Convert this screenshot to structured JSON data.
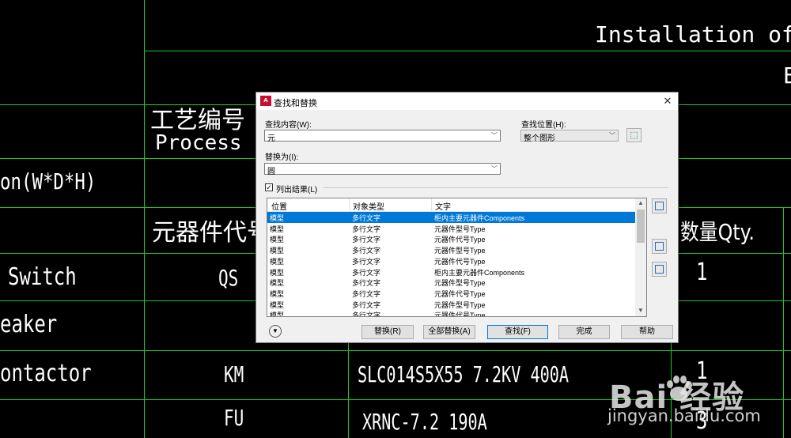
{
  "cad": {
    "install_title": "Installation of",
    "row2_partial": "E",
    "process_label_cn": "工艺编号",
    "process_label_en": "Process",
    "dim_label": "on(W*D*H)",
    "component_code_label": "元器件代号",
    "qty_label": "数量Qty.",
    "switch_label": "Switch",
    "qs": "QS",
    "qty1": "1",
    "breaker_label": "eaker",
    "contactor_label": "ontactor",
    "km": "KM",
    "km_spec": "SLC014S5X55 7.2KV  400A",
    "qty_km": "1",
    "fu": "FU",
    "fu_spec": "XRNC-7.2  190A",
    "qty_fu": "3"
  },
  "dialog": {
    "app_icon": "A",
    "title": "查找和替换",
    "close_glyph": "✕",
    "find_label": "查找内容(W):",
    "find_value": "元",
    "find_in_label": "查找位置(H):",
    "find_in_value": "整个图形",
    "replace_label": "替换为(I):",
    "replace_value": "圆",
    "list_results_label": "列出结果(L)",
    "list_results_checked": "✓",
    "columns": [
      "位置",
      "对象类型",
      "文字"
    ],
    "rows": [
      {
        "location": "模型",
        "type": "多行文字",
        "text": "柜内主要元器件Components"
      },
      {
        "location": "模型",
        "type": "多行文字",
        "text": "元器件型号Type"
      },
      {
        "location": "模型",
        "type": "多行文字",
        "text": "元器件代号Type"
      },
      {
        "location": "模型",
        "type": "多行文字",
        "text": "元器件型号Type"
      },
      {
        "location": "模型",
        "type": "多行文字",
        "text": "元器件代号Type"
      },
      {
        "location": "模型",
        "type": "多行文字",
        "text": "柜内主要元器件Components"
      },
      {
        "location": "模型",
        "type": "多行文字",
        "text": "元器件型号Type"
      },
      {
        "location": "模型",
        "type": "多行文字",
        "text": "元器件代号Type"
      },
      {
        "location": "模型",
        "type": "多行文字",
        "text": "元器件型号Type"
      },
      {
        "location": "模型",
        "type": "多行文字",
        "text": "元器件代号Type"
      }
    ],
    "buttons": {
      "replace": "替换(R)",
      "replace_all": "全部替换(A)",
      "find": "查找(F)",
      "done": "完成",
      "help": "帮助"
    }
  },
  "watermark": {
    "logo": "Bai  经验",
    "url": "jingyan.baidu.com"
  },
  "colors": {
    "grid": "#1ec81e",
    "selection": "#0078d7"
  }
}
